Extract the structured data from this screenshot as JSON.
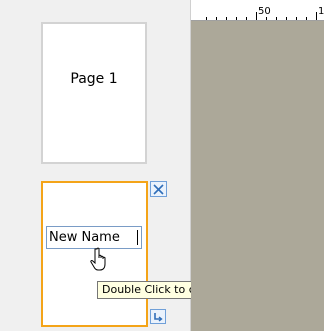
{
  "thumbnails": {
    "page1": {
      "label": "Page 1"
    },
    "page2": {
      "edit_value": "New Name"
    }
  },
  "tooltip": {
    "text": "Double Click to change name"
  },
  "ruler": {
    "labels": [
      "50",
      "1"
    ]
  },
  "icons": {
    "delete": "close-x-icon",
    "insert": "insert-page-arrow-icon",
    "cursor": "hand-pointer-icon"
  },
  "colors": {
    "selected_border": "#f4a418",
    "unselected_border": "#d3d3d3",
    "canvas_background": "#aca899",
    "tooltip_background": "#ffffe1",
    "button_border": "#6f9fd8"
  }
}
